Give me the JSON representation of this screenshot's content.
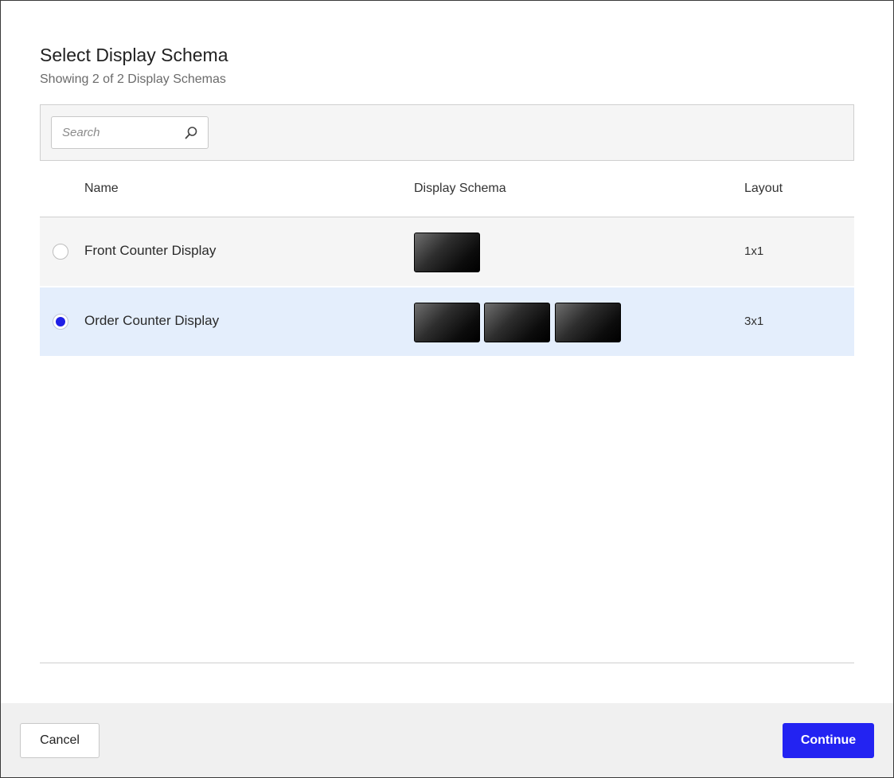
{
  "dialog": {
    "title": "Select Display Schema",
    "subtitle": "Showing 2 of 2 Display Schemas"
  },
  "search": {
    "placeholder": "Search",
    "value": "",
    "icon": "search-icon"
  },
  "table": {
    "columns": [
      "Name",
      "Display Schema",
      "Layout"
    ],
    "rows": [
      {
        "name": "Front Counter Display",
        "layout": "1x1",
        "screen_count": 1,
        "selected": false
      },
      {
        "name": "Order Counter Display",
        "layout": "3x1",
        "screen_count": 3,
        "selected": true
      }
    ]
  },
  "footer": {
    "cancel_label": "Cancel",
    "continue_label": "Continue"
  },
  "colors": {
    "accent": "#2323f2",
    "selected_row": "#e4eefc",
    "row_bg": "#f5f5f5"
  }
}
